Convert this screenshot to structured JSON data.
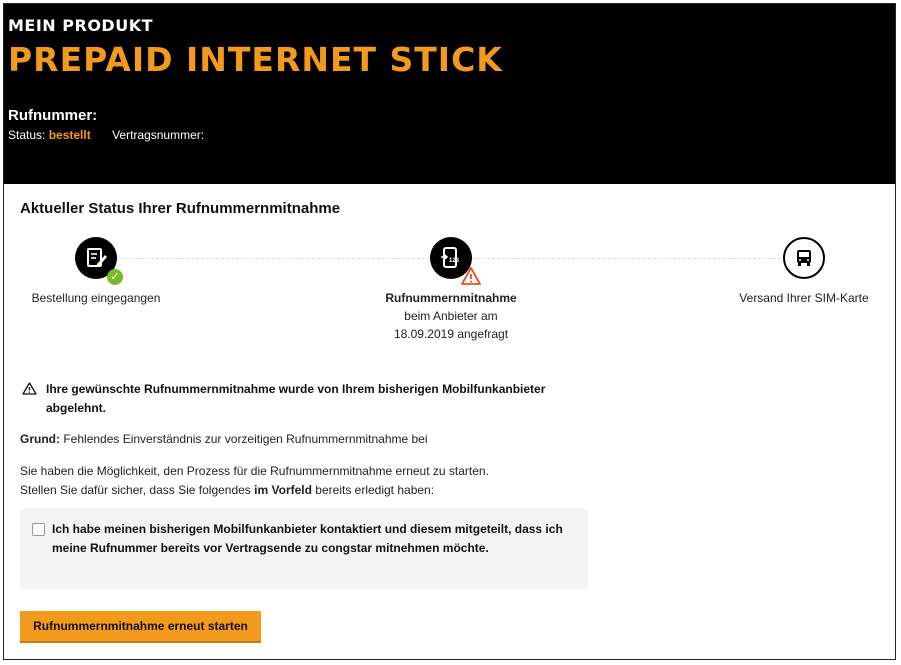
{
  "header": {
    "section_label": "MEIN PRODUKT",
    "product_title": "PREPAID INTERNET STICK",
    "rufnummer_label": "Rufnummer:",
    "status_label": "Status:",
    "status_value": "bestellt",
    "vertrag_label": "Vertragsnummer:"
  },
  "main": {
    "section_title": "Aktueller Status Ihrer Rufnummernmitnahme",
    "steps": [
      {
        "icon": "order-form-icon",
        "label": "Bestellung eingegangen",
        "state": "done"
      },
      {
        "icon": "phone-number-transfer-icon",
        "label_bold": "Rufnummernmitnahme",
        "line2": "beim Anbieter am",
        "line3": "18.09.2019 angefragt",
        "state": "warning"
      },
      {
        "icon": "truck-icon",
        "label": "Versand Ihrer SIM-Karte",
        "state": "pending"
      }
    ],
    "warning_text": "Ihre gewünschte Rufnummernmitnahme wurde von Ihrem bisherigen Mobilfunkanbieter abgelehnt.",
    "grund_label": "Grund:",
    "grund_text": "Fehlendes Einverständnis zur vorzeitigen Rufnummernmitnahme bei",
    "info_line1": "Sie haben die Möglichkeit, den Prozess für die Rufnummernmitnahme erneut zu starten.",
    "info_line2_a": "Stellen Sie dafür sicher, dass Sie folgendes",
    "info_line2_b": "im Vorfeld",
    "info_line2_c": "bereits erledigt haben:",
    "checkbox_text": "Ich habe meinen bisherigen Mobilfunkanbieter kontaktiert und diesem mitgeteilt, dass ich meine Rufnummer bereits vor Vertragsende zu congstar mitnehmen möchte.",
    "restart_button": "Rufnummernmitnahme erneut starten"
  },
  "colors": {
    "accent": "#f39a1c",
    "success": "#7bb928",
    "header_bg": "#000000"
  }
}
